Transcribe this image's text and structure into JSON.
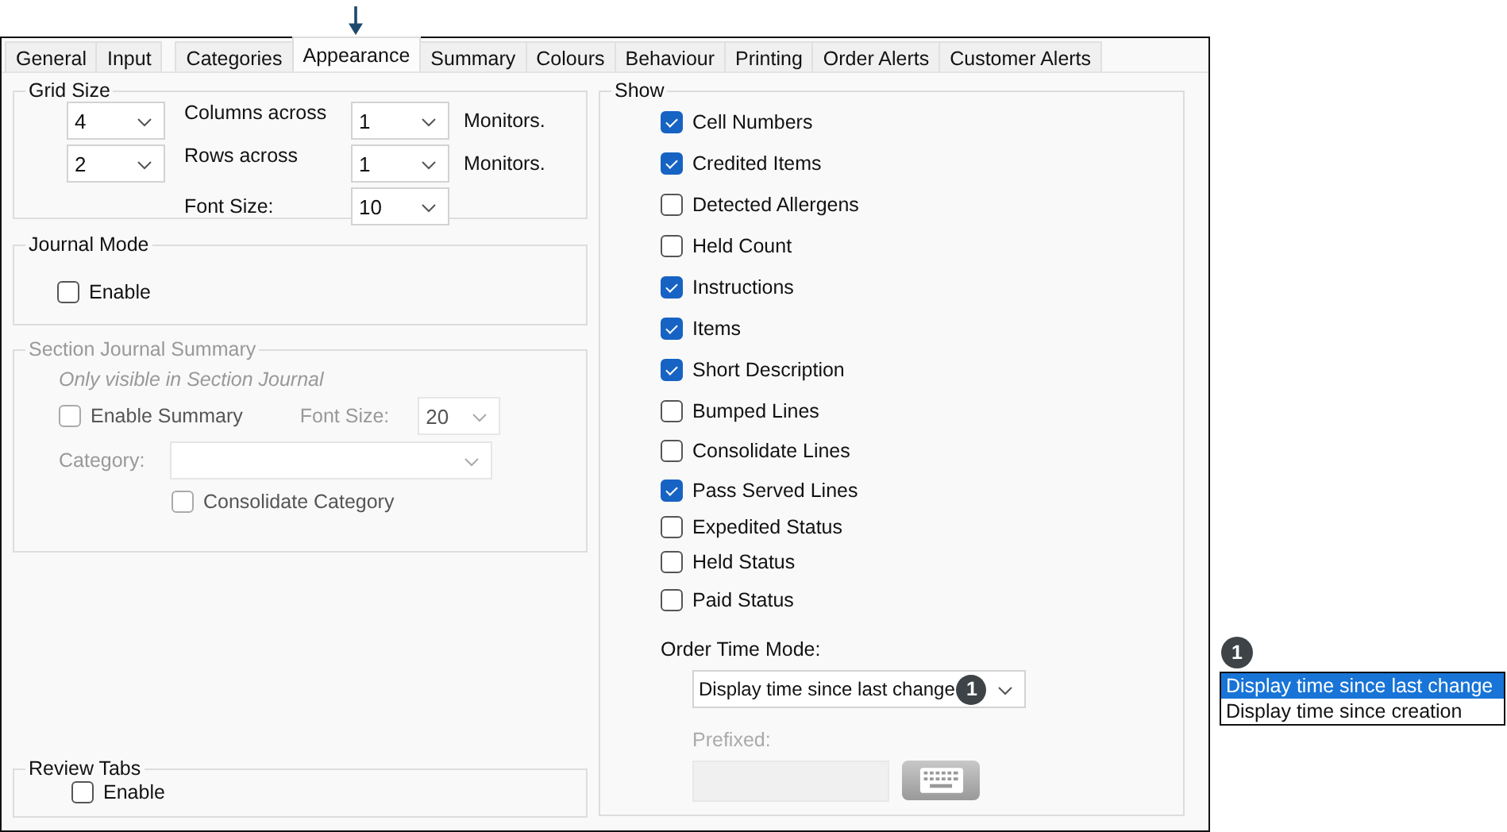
{
  "tabs": [
    {
      "label": "General",
      "selected": false
    },
    {
      "label": "Input",
      "selected": false
    },
    {
      "label": "Categories",
      "selected": false
    },
    {
      "label": "Appearance",
      "selected": true
    },
    {
      "label": "Summary",
      "selected": false
    },
    {
      "label": "Colours",
      "selected": false
    },
    {
      "label": "Behaviour",
      "selected": false
    },
    {
      "label": "Printing",
      "selected": false
    },
    {
      "label": "Order Alerts",
      "selected": false
    },
    {
      "label": "Customer Alerts",
      "selected": false
    }
  ],
  "grid_size": {
    "title": "Grid Size",
    "rows": [
      {
        "value": "4",
        "label": "Columns across",
        "monitors": "1",
        "suffix": "Monitors."
      },
      {
        "value": "2",
        "label": "Rows across",
        "monitors": "1",
        "suffix": "Monitors."
      }
    ],
    "font_size": {
      "label": "Font Size:",
      "value": "10"
    }
  },
  "journal_mode": {
    "title": "Journal Mode",
    "enable": {
      "label": "Enable",
      "checked": false
    }
  },
  "section_journal_summary": {
    "title": "Section Journal Summary",
    "disabled": true,
    "note": "Only visible in Section Journal",
    "enable_summary": {
      "label": "Enable Summary",
      "checked": false
    },
    "font_size": {
      "label": "Font Size:",
      "value": "20"
    },
    "category": {
      "label": "Category:"
    },
    "consolidate_category": {
      "label": "Consolidate Category",
      "checked": false
    }
  },
  "review_tabs": {
    "title": "Review Tabs",
    "enable": {
      "label": "Enable",
      "checked": false
    }
  },
  "show": {
    "title": "Show",
    "items": [
      {
        "label": "Cell Numbers",
        "checked": true
      },
      {
        "label": "Credited Items",
        "checked": true
      },
      {
        "label": "Detected Allergens",
        "checked": false
      },
      {
        "label": "Held Count",
        "checked": false
      },
      {
        "label": "Instructions",
        "checked": true
      },
      {
        "label": "Items",
        "checked": true
      },
      {
        "label": "Short Description",
        "checked": true
      },
      {
        "label": "Bumped Lines",
        "checked": false
      },
      {
        "label": "Consolidate Lines",
        "checked": false
      },
      {
        "label": "Pass Served Lines",
        "checked": true
      },
      {
        "label": "Expedited Status",
        "checked": false
      },
      {
        "label": "Held Status",
        "checked": false
      },
      {
        "label": "Paid Status",
        "checked": false
      }
    ],
    "order_time_mode": {
      "label": "Order Time Mode:",
      "value": "Display time since last change",
      "callout": "1"
    },
    "prefixed": {
      "label": "Prefixed:",
      "disabled": true
    }
  },
  "callout": {
    "number": "1",
    "options": [
      {
        "label": "Display time since last change",
        "selected": true
      },
      {
        "label": "Display time since creation",
        "selected": false
      }
    ]
  }
}
